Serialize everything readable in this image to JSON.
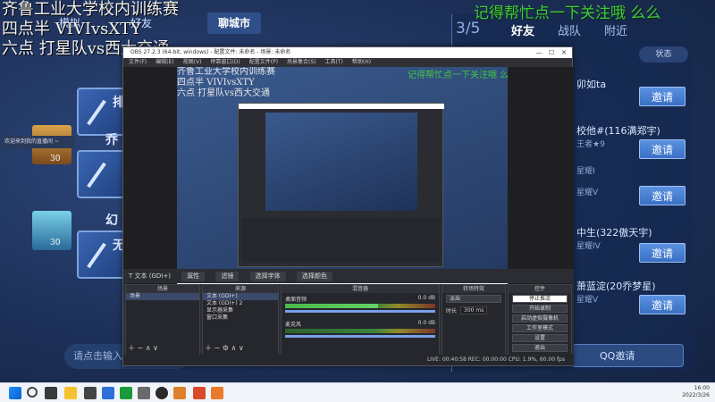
{
  "overlay": {
    "line1": "齐鲁工业大学校内训练赛",
    "line2": "四点半 VIVIvsXTY",
    "line3": "六点 打星队vs西大交通",
    "notice": "记得帮忙点一下关注哦 么么"
  },
  "game": {
    "tabs": [
      "模拟",
      "好友",
      "聊城市"
    ],
    "friend_count": "3/5",
    "friend_tabs": [
      "好友",
      "战队",
      "附近"
    ],
    "status_label": "状态",
    "invite_label": "邀请",
    "friends": [
      {
        "name": "卯如ta",
        "sub": ""
      },
      {
        "name": "校他#(116满郑宇)",
        "sub": "王者★9"
      },
      {
        "name": "",
        "sub": "星耀I"
      },
      {
        "name": "",
        "sub": "星耀V"
      },
      {
        "name": "中生(322傲天宇)",
        "sub": "星耀IV"
      },
      {
        "name": "萧蓝淀(20乔梦星)",
        "sub": "星耀V"
      }
    ],
    "left_labels": [
      "排",
      "乔",
      "幻",
      "无"
    ],
    "level_badges": [
      "30",
      "30"
    ],
    "chat_placeholder": "请点击输入",
    "qq_label": "QQ邀请",
    "side_msg": "欢迎来到我的直播间 ~"
  },
  "obs": {
    "title": "OBS 27.2.3 (64-bit, windows) - 配置文件: 未命名 - 场景: 未命名",
    "menu": [
      "文件(F)",
      "编辑(E)",
      "视图(V)",
      "停靠窗口(D)",
      "配置文件(P)",
      "场景集合(S)",
      "工具(T)",
      "帮助(H)"
    ],
    "source_name": "文本 (GDI+)",
    "source_buttons": [
      "属性",
      "滤镜",
      "选择字体",
      "选择颜色"
    ],
    "dock_titles": [
      "场景",
      "来源",
      "混音器",
      "转场特效",
      "控件"
    ],
    "scenes": [
      "场景"
    ],
    "sources": [
      "文本 (GDI+)",
      "文本 (GDI+) 2",
      "显示器采集",
      "窗口采集"
    ],
    "mixer": [
      {
        "name": "桌面音频",
        "db": "0.0 dB",
        "level": 0.62
      },
      {
        "name": "麦克风",
        "db": "0.0 dB",
        "level": 0.0
      }
    ],
    "transition": {
      "type": "淡出",
      "duration_label": "时长",
      "duration": "300 ms"
    },
    "controls": [
      "停止推流",
      "开始录制",
      "启动虚拟摄像机",
      "工作室模式",
      "设置",
      "退出"
    ],
    "status": "LIVE: 00:40:58    REC: 00:00:00    CPU: 1.9%, 60.00 fps"
  },
  "taskbar": {
    "time": "16:00",
    "date": "2022/3/26"
  }
}
